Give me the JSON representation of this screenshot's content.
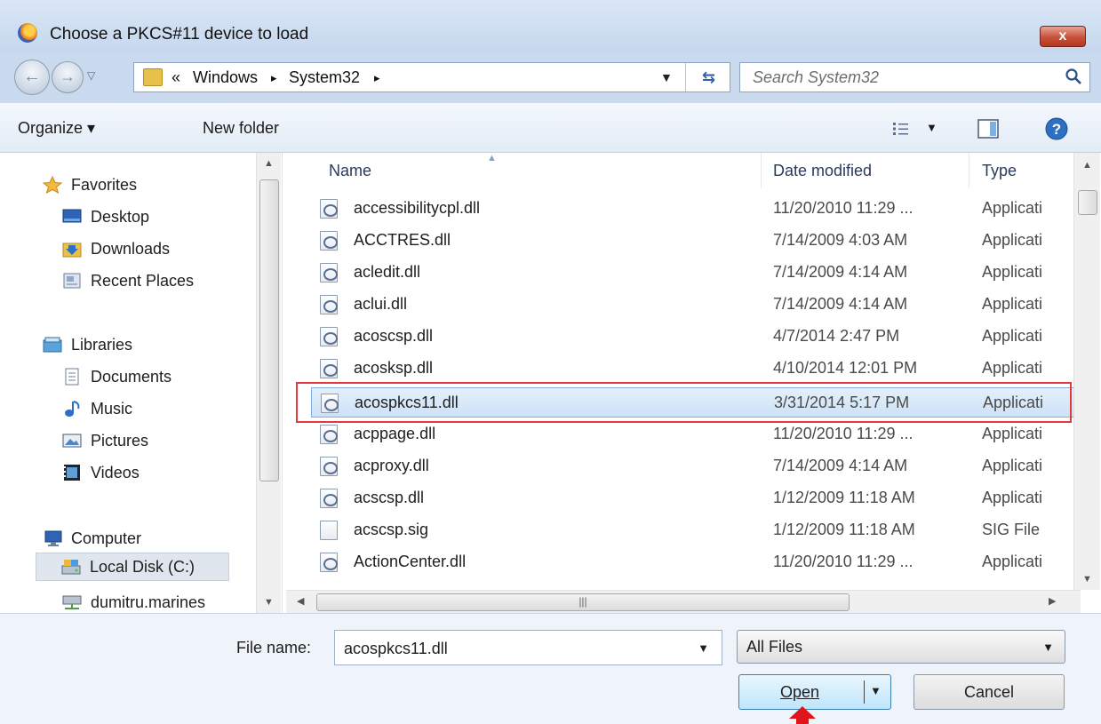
{
  "window": {
    "title": "Choose a PKCS#11 device to load",
    "close_label": "x"
  },
  "address": {
    "overflow": "«",
    "crumbs": [
      "Windows",
      "System32"
    ],
    "separator": "▸",
    "search_placeholder": "Search System32"
  },
  "toolbar": {
    "organize": "Organize ▾",
    "new_folder": "New folder"
  },
  "navpane": {
    "items": [
      {
        "label": "Favorites",
        "icon": "star-icon"
      },
      {
        "label": "Desktop",
        "icon": "desktop-icon"
      },
      {
        "label": "Downloads",
        "icon": "downloads-icon"
      },
      {
        "label": "Recent Places",
        "icon": "recent-places-icon"
      },
      {
        "label": "Libraries",
        "icon": "libraries-icon"
      },
      {
        "label": "Documents",
        "icon": "documents-icon"
      },
      {
        "label": "Music",
        "icon": "music-icon"
      },
      {
        "label": "Pictures",
        "icon": "pictures-icon"
      },
      {
        "label": "Videos",
        "icon": "videos-icon"
      },
      {
        "label": "Computer",
        "icon": "computer-icon"
      },
      {
        "label": "Local Disk (C:)",
        "icon": "drive-icon"
      },
      {
        "label": "dumitru.marines",
        "icon": "network-drive-icon"
      }
    ]
  },
  "filelist": {
    "columns": {
      "name": "Name",
      "date": "Date modified",
      "type": "Type"
    },
    "rows": [
      {
        "name": "accessibilitycpl.dll",
        "date": "11/20/2010 11:29 ...",
        "type": "Applicati"
      },
      {
        "name": "ACCTRES.dll",
        "date": "7/14/2009 4:03 AM",
        "type": "Applicati"
      },
      {
        "name": "acledit.dll",
        "date": "7/14/2009 4:14 AM",
        "type": "Applicati"
      },
      {
        "name": "aclui.dll",
        "date": "7/14/2009 4:14 AM",
        "type": "Applicati"
      },
      {
        "name": "acoscsp.dll",
        "date": "4/7/2014 2:47 PM",
        "type": "Applicati"
      },
      {
        "name": "acosksp.dll",
        "date": "4/10/2014 12:01 PM",
        "type": "Applicati"
      },
      {
        "name": "acospkcs11.dll",
        "date": "3/31/2014 5:17 PM",
        "type": "Applicati"
      },
      {
        "name": "acppage.dll",
        "date": "11/20/2010 11:29 ...",
        "type": "Applicati"
      },
      {
        "name": "acproxy.dll",
        "date": "7/14/2009 4:14 AM",
        "type": "Applicati"
      },
      {
        "name": "acscsp.dll",
        "date": "1/12/2009 11:18 AM",
        "type": "Applicati"
      },
      {
        "name": "acscsp.sig",
        "date": "1/12/2009 11:18 AM",
        "type": "SIG File"
      },
      {
        "name": "ActionCenter.dll",
        "date": "11/20/2010 11:29 ...",
        "type": "Applicati"
      }
    ]
  },
  "bottom": {
    "file_name_label": "File name:",
    "file_name_value": "acospkcs11.dll",
    "filter_value": "All Files",
    "open_label": "Open",
    "cancel_label": "Cancel"
  },
  "colors": {
    "selection_outline": "#e23a3a",
    "selected_row": "#cde2f7",
    "pointer_arrow": "#e0141a"
  }
}
